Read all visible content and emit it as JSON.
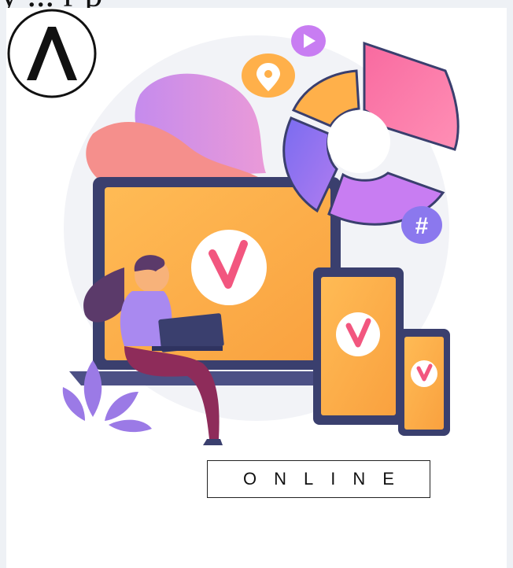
{
  "page": {
    "top_text": "y ... r p",
    "brand_label": "ONLINE"
  },
  "icons": {
    "location": "location-pin-icon",
    "play": "play-icon",
    "hash": "hashtag-icon",
    "check": "checkmark-icon",
    "logo": "lambda-logo"
  },
  "colors": {
    "orange": "#ffb04a",
    "pink": "#f86aa0",
    "purple": "#a070ee",
    "navy": "#3a3f6e",
    "blob": "#e19ce6",
    "coral": "#f58f8c"
  }
}
